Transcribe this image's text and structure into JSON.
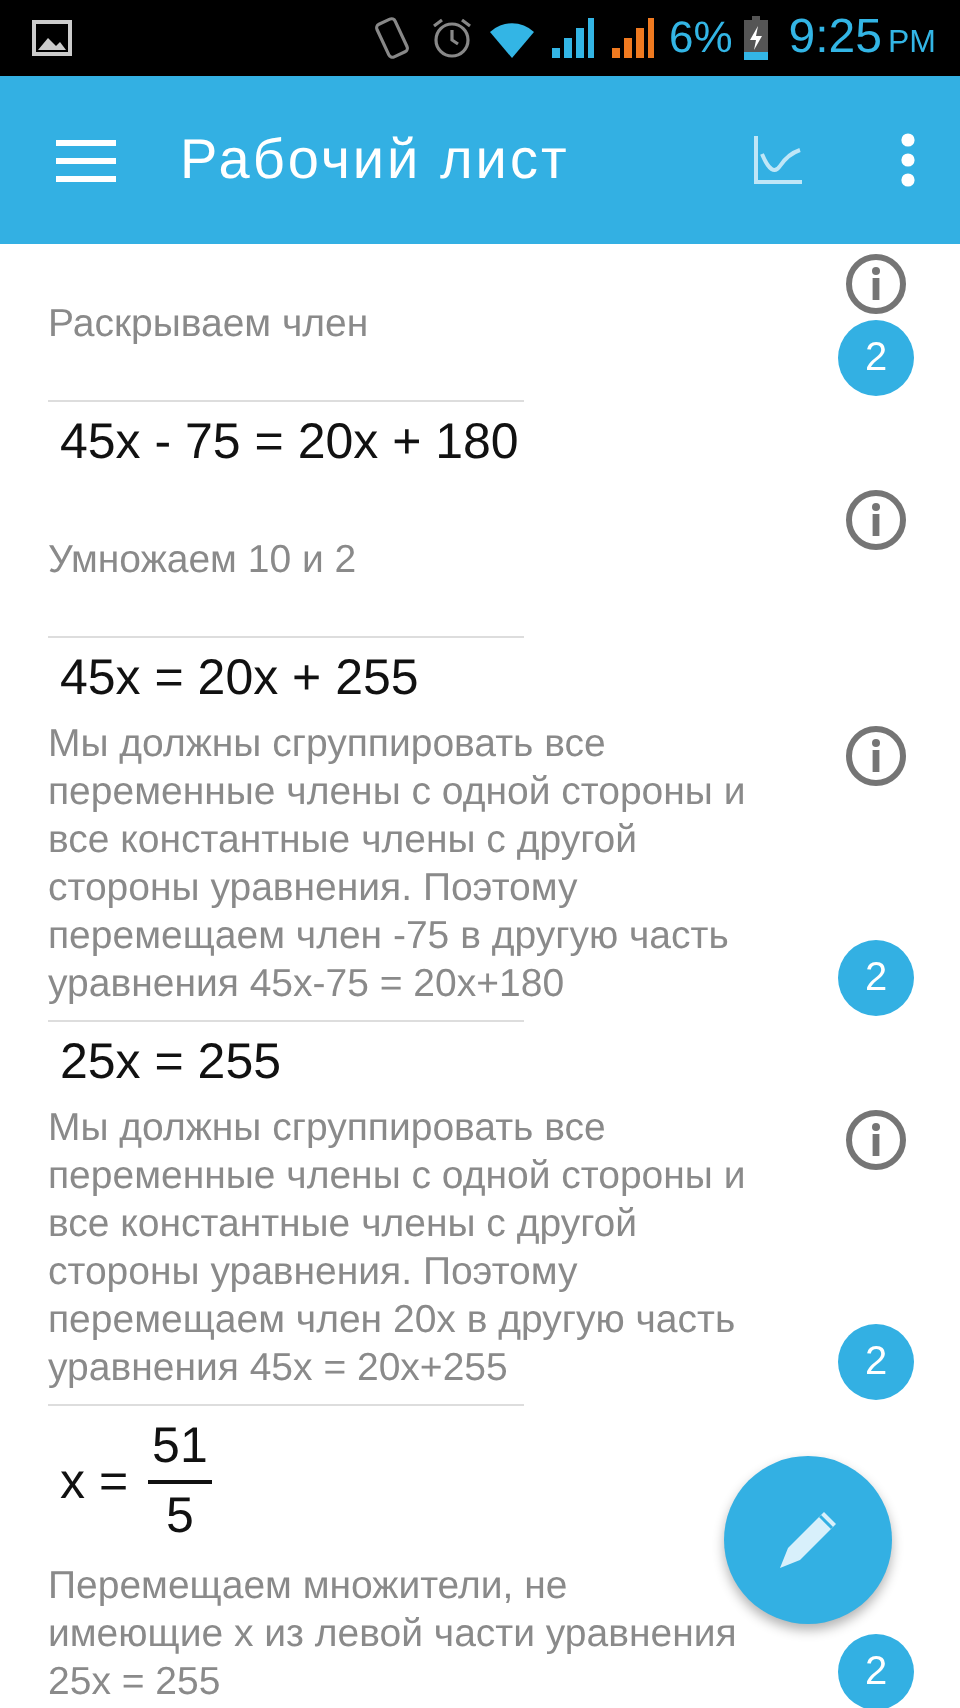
{
  "status_bar": {
    "battery": "6%",
    "time": "9:25",
    "ampm": "PM"
  },
  "app_bar": {
    "title": "Рабочий лист"
  },
  "items": [
    {
      "kind": "step",
      "text": "Раскрываем член",
      "info": true,
      "badge": "2"
    },
    {
      "kind": "equation",
      "text": "45x - 75 = 20x + 180"
    },
    {
      "kind": "step",
      "text": "Умножаем 10 и 2",
      "info": true
    },
    {
      "kind": "equation",
      "text": "45x = 20x + 255"
    },
    {
      "kind": "step",
      "text": "Мы должны сгруппировать все переменные члены с одной стороны и все константные члены с другой стороны уравнения. Поэтому перемещаем член -75 в другую часть уравнения 45x-75 = 20x+180",
      "info": true,
      "badge": "2"
    },
    {
      "kind": "equation",
      "text": "25x = 255"
    },
    {
      "kind": "step",
      "text": "Мы должны сгруппировать все переменные члены с одной стороны и все константные члены с другой стороны уравнения. Поэтому перемещаем член 20x в другую часть уравнения 45x = 20x+255",
      "info": true,
      "badge": "2"
    },
    {
      "kind": "fraction",
      "lhs": "x =",
      "numerator": "51",
      "denominator": "5"
    },
    {
      "kind": "step",
      "text": "Перемещаем множители, не имеющие x из левой части уравнения 25x = 255",
      "info": false,
      "badge": "2"
    }
  ]
}
